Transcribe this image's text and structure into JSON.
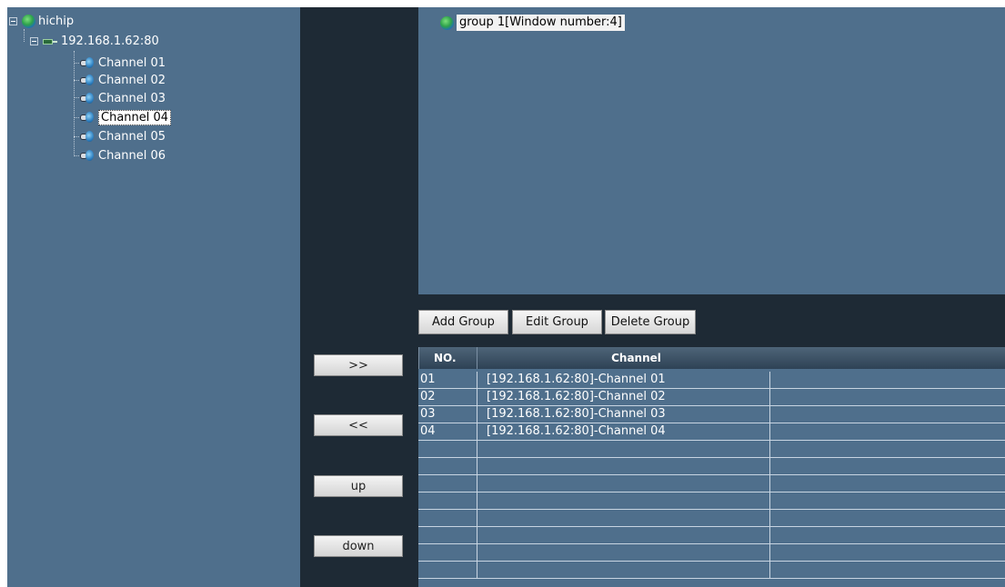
{
  "colors": {
    "panel_bg": "#4f6f8c",
    "dark_bg": "#1e2a35",
    "header_bg": "#2e4255",
    "grid_line": "#c8d5e2"
  },
  "tree": {
    "root": {
      "label": "hichip",
      "icon": "globe-icon"
    },
    "device": {
      "label": "192.168.1.62:80",
      "icon": "nvr-icon"
    },
    "channels": [
      {
        "label": "Channel 01",
        "icon": "camera-icon"
      },
      {
        "label": "Channel 02",
        "icon": "camera-icon"
      },
      {
        "label": "Channel 03",
        "icon": "camera-icon"
      },
      {
        "label": "Channel 04",
        "icon": "camera-icon",
        "selected": true
      },
      {
        "label": "Channel 05",
        "icon": "camera-icon"
      },
      {
        "label": "Channel 06",
        "icon": "camera-icon"
      }
    ]
  },
  "transfer": {
    "add_label": ">>",
    "remove_label": "<<",
    "up_label": "up",
    "down_label": "down"
  },
  "groups": {
    "items": [
      {
        "label": "group 1[Window number:4]",
        "icon": "globe-icon"
      }
    ],
    "add_label": "Add Group",
    "edit_label": "Edit Group",
    "delete_label": "Delete Group"
  },
  "table": {
    "headers": {
      "no": "NO.",
      "channel": "Channel"
    },
    "rows": [
      {
        "no": "01",
        "channel": "[192.168.1.62:80]-Channel 01"
      },
      {
        "no": "02",
        "channel": "[192.168.1.62:80]-Channel 02"
      },
      {
        "no": "03",
        "channel": "[192.168.1.62:80]-Channel 03"
      },
      {
        "no": "04",
        "channel": "[192.168.1.62:80]-Channel 04"
      },
      {
        "no": "",
        "channel": ""
      },
      {
        "no": "",
        "channel": ""
      },
      {
        "no": "",
        "channel": ""
      },
      {
        "no": "",
        "channel": ""
      },
      {
        "no": "",
        "channel": ""
      },
      {
        "no": "",
        "channel": ""
      },
      {
        "no": "",
        "channel": ""
      },
      {
        "no": "",
        "channel": ""
      }
    ]
  }
}
